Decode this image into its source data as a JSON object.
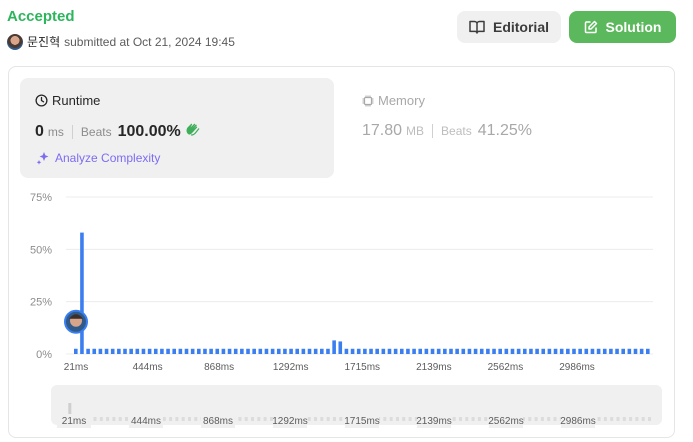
{
  "header": {
    "status": "Accepted",
    "username": "문진혁",
    "submitted_text": "submitted at Oct 21, 2024 19:45",
    "editorial_label": "Editorial",
    "solution_label": "Solution"
  },
  "runtime": {
    "title": "Runtime",
    "value": "0",
    "unit": "ms",
    "beats_label": "Beats",
    "beats_value": "100.00%",
    "analyze_label": "Analyze Complexity"
  },
  "memory": {
    "title": "Memory",
    "value": "17.80",
    "unit": "MB",
    "beats_label": "Beats",
    "beats_value": "41.25%"
  },
  "colors": {
    "accepted": "#2db55d",
    "bar": "#3b7ef0",
    "solution_button": "#5cb85c",
    "analyze": "#7c6cf2"
  },
  "chart_data": {
    "type": "bar",
    "y_ticks": [
      "75%",
      "50%",
      "25%",
      "0%"
    ],
    "ylim": [
      0,
      75
    ],
    "x_ticks": [
      "21ms",
      "444ms",
      "868ms",
      "1292ms",
      "1715ms",
      "2139ms",
      "2562ms",
      "2986ms"
    ],
    "values": [
      2.5,
      58,
      2.5,
      2.5,
      2.5,
      2.5,
      2.5,
      2.5,
      2.5,
      2.5,
      2.5,
      2.5,
      2.5,
      2.5,
      2.5,
      2.5,
      2.5,
      2.5,
      2.5,
      2.5,
      2.5,
      2.5,
      2.5,
      2.5,
      2.5,
      2.5,
      2.5,
      2.5,
      2.5,
      2.5,
      2.5,
      2.5,
      2.5,
      2.5,
      2.5,
      2.5,
      2.5,
      2.5,
      2.5,
      2.5,
      2.5,
      2.5,
      6.5,
      6,
      2.5,
      2.5,
      2.5,
      2.5,
      2.5,
      2.5,
      2.5,
      2.5,
      2.5,
      2.5,
      2.5,
      2.5,
      2.5,
      2.5,
      2.5,
      2.5,
      2.5,
      2.5,
      2.5,
      2.5,
      2.5,
      2.5,
      2.5,
      2.5,
      2.5,
      2.5,
      2.5,
      2.5,
      2.5,
      2.5,
      2.5,
      2.5,
      2.5,
      2.5,
      2.5,
      2.5,
      2.5,
      2.5,
      2.5,
      2.5,
      2.5,
      2.5,
      2.5,
      2.5,
      2.5,
      2.5,
      2.5,
      2.5,
      2.5,
      2.5
    ],
    "user_marker_index": 0,
    "grid": true
  },
  "scrubber": {
    "x_ticks": [
      "21ms",
      "444ms",
      "868ms",
      "1292ms",
      "1715ms",
      "2139ms",
      "2562ms",
      "2986ms"
    ]
  }
}
